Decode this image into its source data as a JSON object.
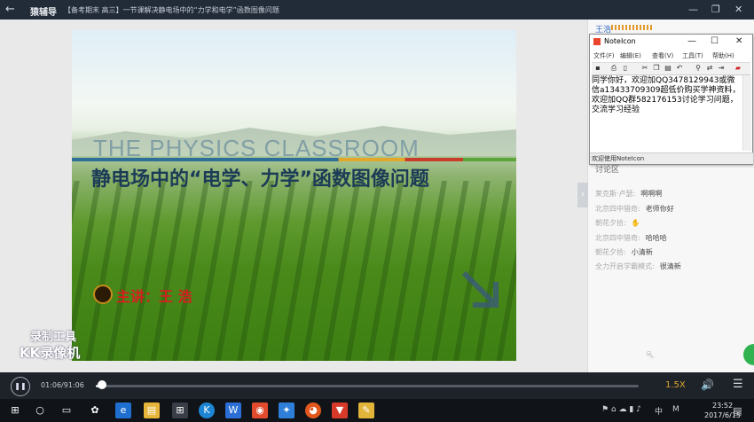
{
  "titlebar": {
    "back_icon": "back-arrow-icon",
    "app_name": "猿辅导",
    "course_title": "【备考期末 高三】一节课解决静电场中的“力学和电学”函数图像问题",
    "minimize": "—",
    "restore": "❐",
    "close": "✕"
  },
  "slide": {
    "english_title": "THE PHYSICS CLASSROOM",
    "chinese_title": "静电场中的“电学、力学”函数图像问题",
    "lecturer": "主讲：王 浩"
  },
  "watermark": {
    "line1": "录制工具",
    "line2": "KK录像机"
  },
  "panel": {
    "teacher_name": "王浩",
    "collapse_icon": "›",
    "discussion_label": "讨论区",
    "messages": [
      {
        "user": "莱克斯·卢瑟:",
        "text": "啊啊啊"
      },
      {
        "user": "北京四中猎奇:",
        "text": "老师你好"
      },
      {
        "user": "朝花夕拾:",
        "text": "✋"
      },
      {
        "user": "北京四中猎奇:",
        "text": "哈哈哈"
      },
      {
        "user": "朝花夕拾:",
        "text": "小清新"
      },
      {
        "user": "全力开启学霸模式:",
        "text": "很清新"
      }
    ]
  },
  "notepad": {
    "title": "NoteIcon",
    "menu": [
      "文件(F)",
      "编辑(E)",
      "查看(V)",
      "工具(T)",
      "帮助(H)"
    ],
    "text": "同学你好，欢迎加QQ3478129943或微信a13433709309超低价购买学神资料，欢迎加QQ群582176153讨论学习问题，交流学习经验",
    "status": "欢迎使用NoteIcon"
  },
  "player": {
    "pause_icon": "❚❚",
    "time": "01:06/91:06",
    "progress": 0.012,
    "speed": "1.5X",
    "volume_icon": "🔊",
    "playlist_icon": "☰"
  },
  "taskbar": {
    "ime": "中",
    "ime2": "M",
    "time": "23:52",
    "date": "2017/6/15"
  }
}
